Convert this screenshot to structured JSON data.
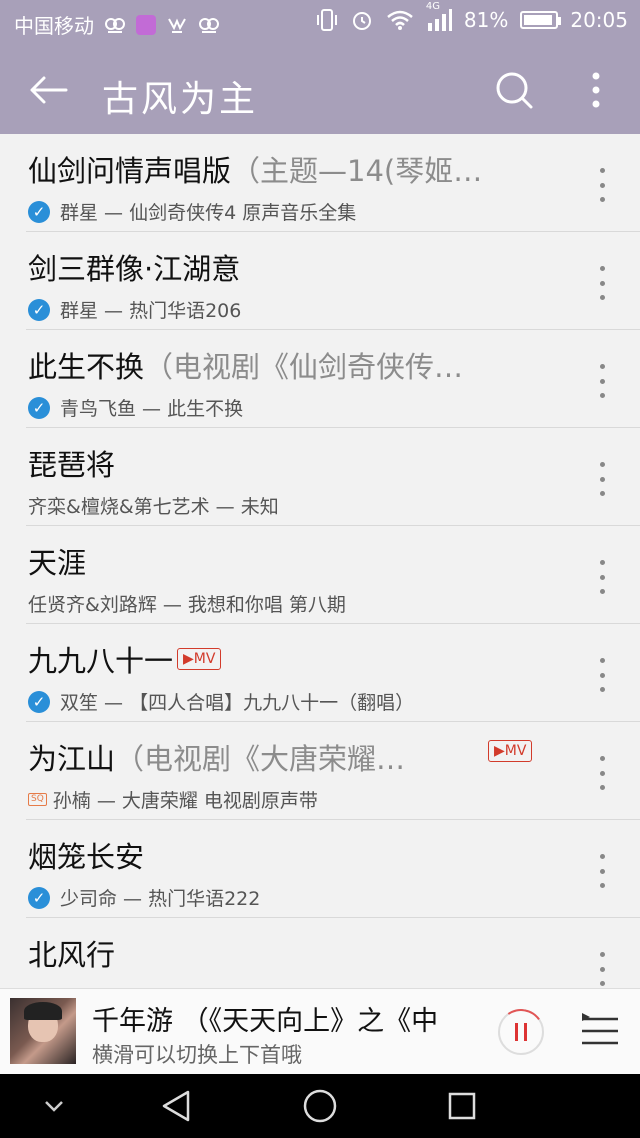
{
  "status_bar": {
    "carrier": "中国移动",
    "network": "4G",
    "battery": "81%",
    "time": "20:05"
  },
  "header": {
    "title": "古风为主"
  },
  "songs": [
    {
      "title": "仙剑问情声唱版",
      "subtitle": "（主题—14(琴姬…",
      "verified": true,
      "artist_album": "群星 — 仙剑奇侠传4 原声音乐全集",
      "mv": false,
      "sq": false
    },
    {
      "title": "剑三群像·江湖意",
      "subtitle": "",
      "verified": true,
      "artist_album": "群星 — 热门华语206",
      "mv": false,
      "sq": false
    },
    {
      "title": "此生不换",
      "subtitle": "（电视剧《仙剑奇侠传…",
      "verified": true,
      "artist_album": "青鸟飞鱼 — 此生不换",
      "mv": false,
      "sq": false
    },
    {
      "title": "琵琶将",
      "subtitle": "",
      "verified": false,
      "artist_album": "齐栾&檀烧&第七艺术 — 未知",
      "mv": false,
      "sq": false
    },
    {
      "title": "天涯",
      "subtitle": "",
      "verified": false,
      "artist_album": "任贤齐&刘路辉 — 我想和你唱 第八期",
      "mv": false,
      "sq": false
    },
    {
      "title": "九九八十一",
      "subtitle": "",
      "verified": true,
      "artist_album": "双笙 — 【四人合唱】九九八十一（翻唱）",
      "mv": true,
      "sq": false
    },
    {
      "title": "为江山",
      "subtitle": "（电视剧《大唐荣耀…",
      "verified": false,
      "artist_album": "孙楠 — 大唐荣耀 电视剧原声带",
      "mv": true,
      "sq": true
    },
    {
      "title": "烟笼长安",
      "subtitle": "",
      "verified": true,
      "artist_album": "少司命 — 热门华语222",
      "mv": false,
      "sq": false
    },
    {
      "title": "北风行",
      "subtitle": "",
      "verified": false,
      "artist_album": "",
      "mv": false,
      "sq": false
    }
  ],
  "badges": {
    "mv": "▶MV",
    "sq": "SQ"
  },
  "player": {
    "now_playing": "千年游 （《天天向上》之《中",
    "hint": "横滑可以切换上下首哦"
  },
  "colors": {
    "header_bg": "#a8a0b9",
    "verified": "#2a8fd8",
    "mv_badge": "#d23b2b",
    "pause": "#dd3333"
  }
}
